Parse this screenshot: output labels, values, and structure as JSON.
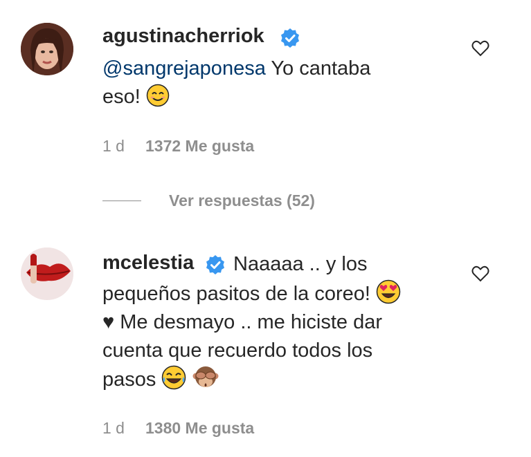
{
  "comments": [
    {
      "username": "agustinacherriok",
      "mention": "@sangrejaponesa",
      "text_line1": " Yo cantaba",
      "text_line2": "eso! ",
      "time": "1 d",
      "likes": "1372 Me gusta"
    },
    {
      "username": "mcelestia",
      "line1": "Naaaaa .. y los",
      "line2": "pequeños pasitos de la coreo! ",
      "line3": "♥ Me desmayo .. me hiciste dar",
      "line4": "cuenta que recuerdo todos los",
      "line5": "pasos ",
      "time": "1 d",
      "likes": "1380 Me gusta"
    }
  ],
  "replies": {
    "label": "Ver respuestas (52)"
  },
  "icons": {
    "verified": "verified-badge-icon",
    "like": "heart-outline-icon",
    "emojis": [
      "smiling-face-icon",
      "heart-eyes-icon",
      "tears-of-joy-icon",
      "see-no-evil-monkey-icon"
    ]
  },
  "colors": {
    "verified": "#3897f0",
    "mention": "#00376b",
    "meta": "#8e8e8e"
  }
}
